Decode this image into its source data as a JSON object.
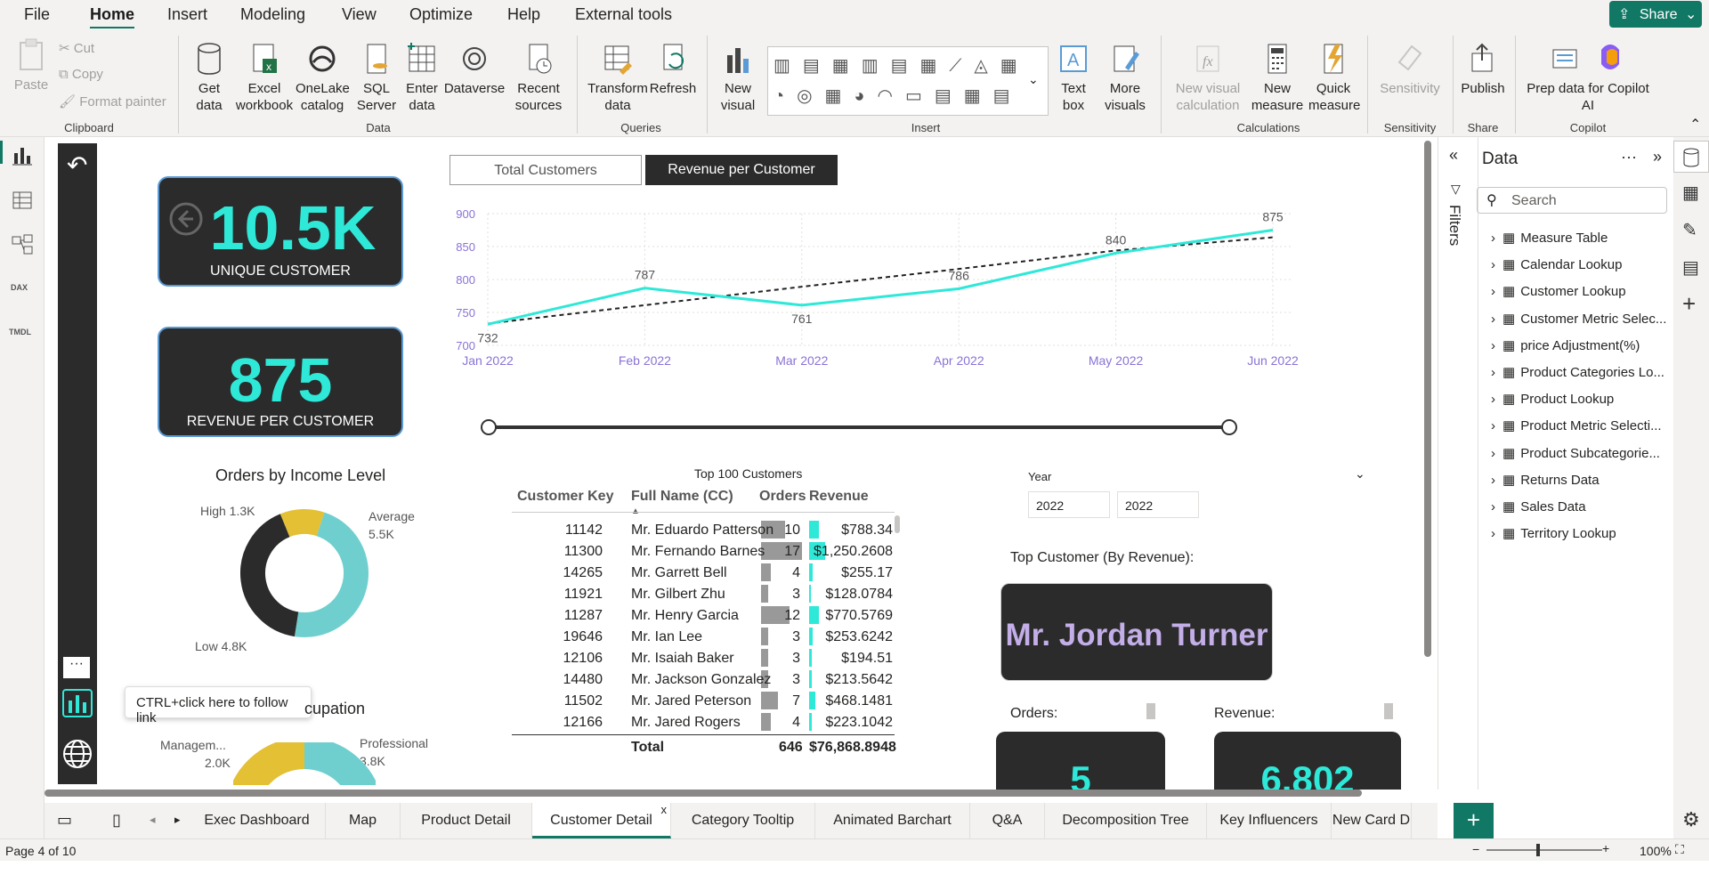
{
  "menu": [
    "File",
    "Home",
    "Insert",
    "Modeling",
    "View",
    "Optimize",
    "Help",
    "External tools"
  ],
  "share": "Share",
  "ribbon": {
    "paste": "Paste",
    "cut": "Cut",
    "copy": "Copy",
    "format_painter": "Format painter",
    "clipboard": "Clipboard",
    "get_data": "Get data",
    "excel": "Excel workbook",
    "onelake": "OneLake catalog",
    "sql": "SQL Server",
    "enter_data": "Enter data",
    "dataverse": "Dataverse",
    "recent": "Recent sources",
    "data_group": "Data",
    "transform": "Transform data",
    "refresh": "Refresh",
    "queries": "Queries",
    "new_visual": "New visual",
    "insert": "Insert",
    "text_box": "Text box",
    "more_visuals": "More visuals",
    "new_visual_calc": "New visual calculation",
    "new_measure": "New measure",
    "quick_measure": "Quick measure",
    "calculations": "Calculations",
    "sensitivity": "Sensitivity",
    "sensitivity_group": "Sensitivity",
    "publish": "Publish",
    "share_group": "Share",
    "prep_copilot": "Prep data for Copilot AI",
    "copilot": "Copilot"
  },
  "kpi": {
    "unique_val": "10.5K",
    "unique_lbl": "UNIQUE CUSTOMER",
    "rev_val": "875",
    "rev_lbl": "REVENUE PER CUSTOMER"
  },
  "toggle": {
    "total": "Total Customers",
    "revenue": "Revenue per Customer"
  },
  "chart_data": {
    "type": "line",
    "categories": [
      "Jan 2022",
      "Feb 2022",
      "Mar 2022",
      "Apr 2022",
      "May 2022",
      "Jun 2022"
    ],
    "series": [
      {
        "values": [
          732,
          787,
          761,
          786,
          840,
          875
        ]
      }
    ],
    "trend": [
      733,
      761,
      789,
      816,
      844,
      864
    ],
    "ylim": [
      700,
      900
    ],
    "yticks": [
      "900",
      "850",
      "800",
      "750",
      "700"
    ],
    "line_color": "#2ee8d8"
  },
  "donut1": {
    "title": "Orders by Income Level",
    "labels": [
      {
        "t": "High 1.3K"
      },
      {
        "t": "Average"
      },
      {
        "t": "5.5K"
      },
      {
        "t": "Low 4.8K"
      }
    ],
    "values": [
      1.3,
      5.5,
      4.8
    ],
    "colors": [
      "#e3c034",
      "#6fcfcf",
      "#2b2b2b"
    ]
  },
  "donut2": {
    "title": "cupation",
    "l1": "Managem...",
    "l1v": "2.0K",
    "l2": "Professional",
    "l2v": "3.8K"
  },
  "tooltip": "CTRL+click here to follow link",
  "table": {
    "title": "Top 100 Customers",
    "headers": [
      "Customer Key",
      "Full Name (CC)",
      "Orders",
      "Revenue"
    ],
    "rows": [
      [
        "11142",
        "Mr. Eduardo Patterson",
        "10",
        "$788.34"
      ],
      [
        "11300",
        "Mr. Fernando Barnes",
        "17",
        "$1,250.2608"
      ],
      [
        "14265",
        "Mr. Garrett Bell",
        "4",
        "$255.17"
      ],
      [
        "11921",
        "Mr. Gilbert Zhu",
        "3",
        "$128.0784"
      ],
      [
        "11287",
        "Mr. Henry Garcia",
        "12",
        "$770.5769"
      ],
      [
        "19646",
        "Mr. Ian Lee",
        "3",
        "$253.6242"
      ],
      [
        "12106",
        "Mr. Isaiah Baker",
        "3",
        "$194.51"
      ],
      [
        "14480",
        "Mr. Jackson Gonzalez",
        "3",
        "$213.5642"
      ],
      [
        "11502",
        "Mr. Jared Peterson",
        "7",
        "$468.1481"
      ],
      [
        "12166",
        "Mr. Jared Rogers",
        "4",
        "$223.1042"
      ]
    ],
    "total_label": "Total",
    "total_orders": "646",
    "total_revenue": "$76,868.8948"
  },
  "year": {
    "label": "Year",
    "from": "2022",
    "to": "2022"
  },
  "top_customer": {
    "label": "Top Customer (By Revenue):",
    "name": "Mr. Jordan Turner",
    "orders_lbl": "Orders:",
    "rev_lbl": "Revenue:",
    "orders_val": "5",
    "rev_val": "6,802"
  },
  "filters": "Filters",
  "data_pane": {
    "title": "Data",
    "search": "Search",
    "items": [
      "Measure Table",
      "Calendar Lookup",
      "Customer Lookup",
      "Customer Metric Selec...",
      "price Adjustment(%)",
      "Product Categories Lo...",
      "Product Lookup",
      "Product Metric Selecti...",
      "Product Subcategorie...",
      "Returns Data",
      "Sales Data",
      "Territory Lookup"
    ]
  },
  "tabs": [
    "Exec Dashboard",
    "Map",
    "Product Detail",
    "Customer Detail",
    "Category Tooltip",
    "Animated Barchart",
    "Q&A",
    "Decomposition Tree",
    "Key Influencers",
    "New Card D"
  ],
  "status": {
    "page": "Page 4 of 10",
    "zoom": "100%"
  }
}
